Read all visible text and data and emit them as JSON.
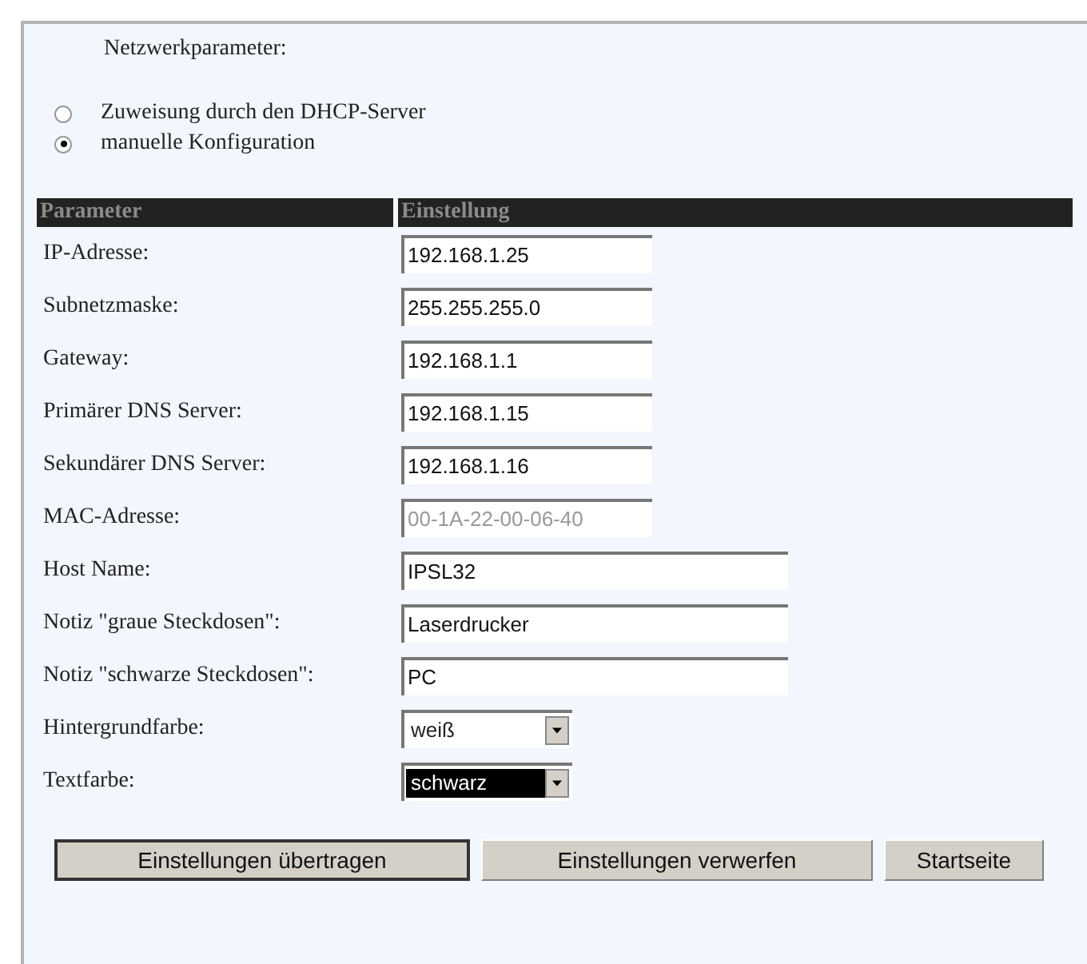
{
  "heading": "Netzwerkparameter:",
  "mode_options": [
    {
      "label": "Zuweisung durch den DHCP-Server",
      "selected": false
    },
    {
      "label": "manuelle Konfiguration",
      "selected": true
    }
  ],
  "table": {
    "columns": [
      "Parameter",
      "Einstellung"
    ],
    "rows": [
      {
        "label": "IP-Adresse:",
        "kind": "text",
        "value": "192.168.1.25",
        "wide": false,
        "disabled": false
      },
      {
        "label": "Subnetzmaske:",
        "kind": "text",
        "value": "255.255.255.0",
        "wide": false,
        "disabled": false
      },
      {
        "label": "Gateway:",
        "kind": "text",
        "value": "192.168.1.1",
        "wide": false,
        "disabled": false
      },
      {
        "label": "Primärer DNS Server:",
        "kind": "text",
        "value": "192.168.1.15",
        "wide": false,
        "disabled": false
      },
      {
        "label": "Sekundärer DNS Server:",
        "kind": "text",
        "value": "192.168.1.16",
        "wide": false,
        "disabled": false
      },
      {
        "label": "MAC-Adresse:",
        "kind": "text",
        "value": "00-1A-22-00-06-40",
        "wide": false,
        "disabled": true
      },
      {
        "label": "Host Name:",
        "kind": "text",
        "value": "IPSL32",
        "wide": true,
        "disabled": false
      },
      {
        "label": "Notiz \"graue Steckdosen\":",
        "kind": "text",
        "value": "Laserdrucker",
        "wide": true,
        "disabled": false
      },
      {
        "label": "Notiz \"schwarze Steckdosen\":",
        "kind": "text",
        "value": "PC",
        "wide": true,
        "disabled": false
      },
      {
        "label": "Hintergrundfarbe:",
        "kind": "select",
        "value": "weiß",
        "focused": false
      },
      {
        "label": "Textfarbe:",
        "kind": "select",
        "value": "schwarz",
        "focused": true
      }
    ]
  },
  "buttons": [
    {
      "label": "Einstellungen übertragen",
      "default": true
    },
    {
      "label": "Einstellungen verwerfen",
      "default": false
    },
    {
      "label": "Startseite",
      "default": false
    }
  ]
}
